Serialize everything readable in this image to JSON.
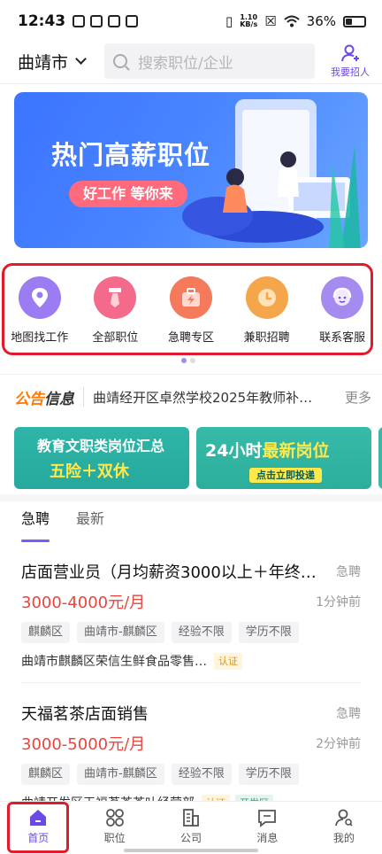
{
  "status_bar": {
    "time": "12:43",
    "speed_top": "1.10",
    "speed_bottom": "KB/s",
    "battery": "36%"
  },
  "header": {
    "city": "曲靖市",
    "search_placeholder": "搜索职位/企业",
    "recruit_label": "我要招人"
  },
  "banner": {
    "title": "热门高薪职位",
    "button": "好工作 等你来"
  },
  "quick_menu": [
    {
      "label": "地图找工作",
      "color": "#9b7cf2",
      "icon": "map-pin-icon"
    },
    {
      "label": "全部职位",
      "color": "#f46a8a",
      "icon": "tie-icon"
    },
    {
      "label": "急聘专区",
      "color": "#f57a5c",
      "icon": "bolt-bag-icon"
    },
    {
      "label": "兼职招聘",
      "color": "#f5a64a",
      "icon": "clock-icon"
    },
    {
      "label": "联系客服",
      "color": "#a58bf0",
      "icon": "support-agent-icon"
    }
  ],
  "notice": {
    "badge_a": "公告",
    "badge_b": "信息",
    "text": "曲靖经开区卓然学校2025年教师补…",
    "more": "更多"
  },
  "promos": [
    {
      "line1": "教育文职类岗位汇总",
      "line2": "五险＋双休"
    },
    {
      "line1a": "24小时",
      "line1b": "最新岗位",
      "cta": "点击立即投递"
    }
  ],
  "tabs": [
    {
      "label": "急聘"
    },
    {
      "label": "最新"
    }
  ],
  "jobs": [
    {
      "title": "店面营业员（月均薪资3000以上＋年终…",
      "urgent": "急聘",
      "salary": "3000-4000元/月",
      "ago": "1分钟前",
      "tags": [
        "麒麟区",
        "曲靖市-麒麟区",
        "经验不限",
        "学历不限"
      ],
      "company": "曲靖市麒麟区荣信生鲜食品零售…",
      "cert": "认证",
      "zone": ""
    },
    {
      "title": "天福茗茶店面销售",
      "urgent": "急聘",
      "salary": "3000-5000元/月",
      "ago": "2分钟前",
      "tags": [
        "麒麟区",
        "曲靖市-麒麟区",
        "经验不限",
        "学历不限"
      ],
      "company": "曲靖开发区天福茗茶茶叶经营部",
      "cert": "认证",
      "zone": "开发区"
    }
  ],
  "bottom_nav": [
    {
      "label": "首页"
    },
    {
      "label": "职位"
    },
    {
      "label": "公司"
    },
    {
      "label": "消息"
    },
    {
      "label": "我的"
    }
  ]
}
